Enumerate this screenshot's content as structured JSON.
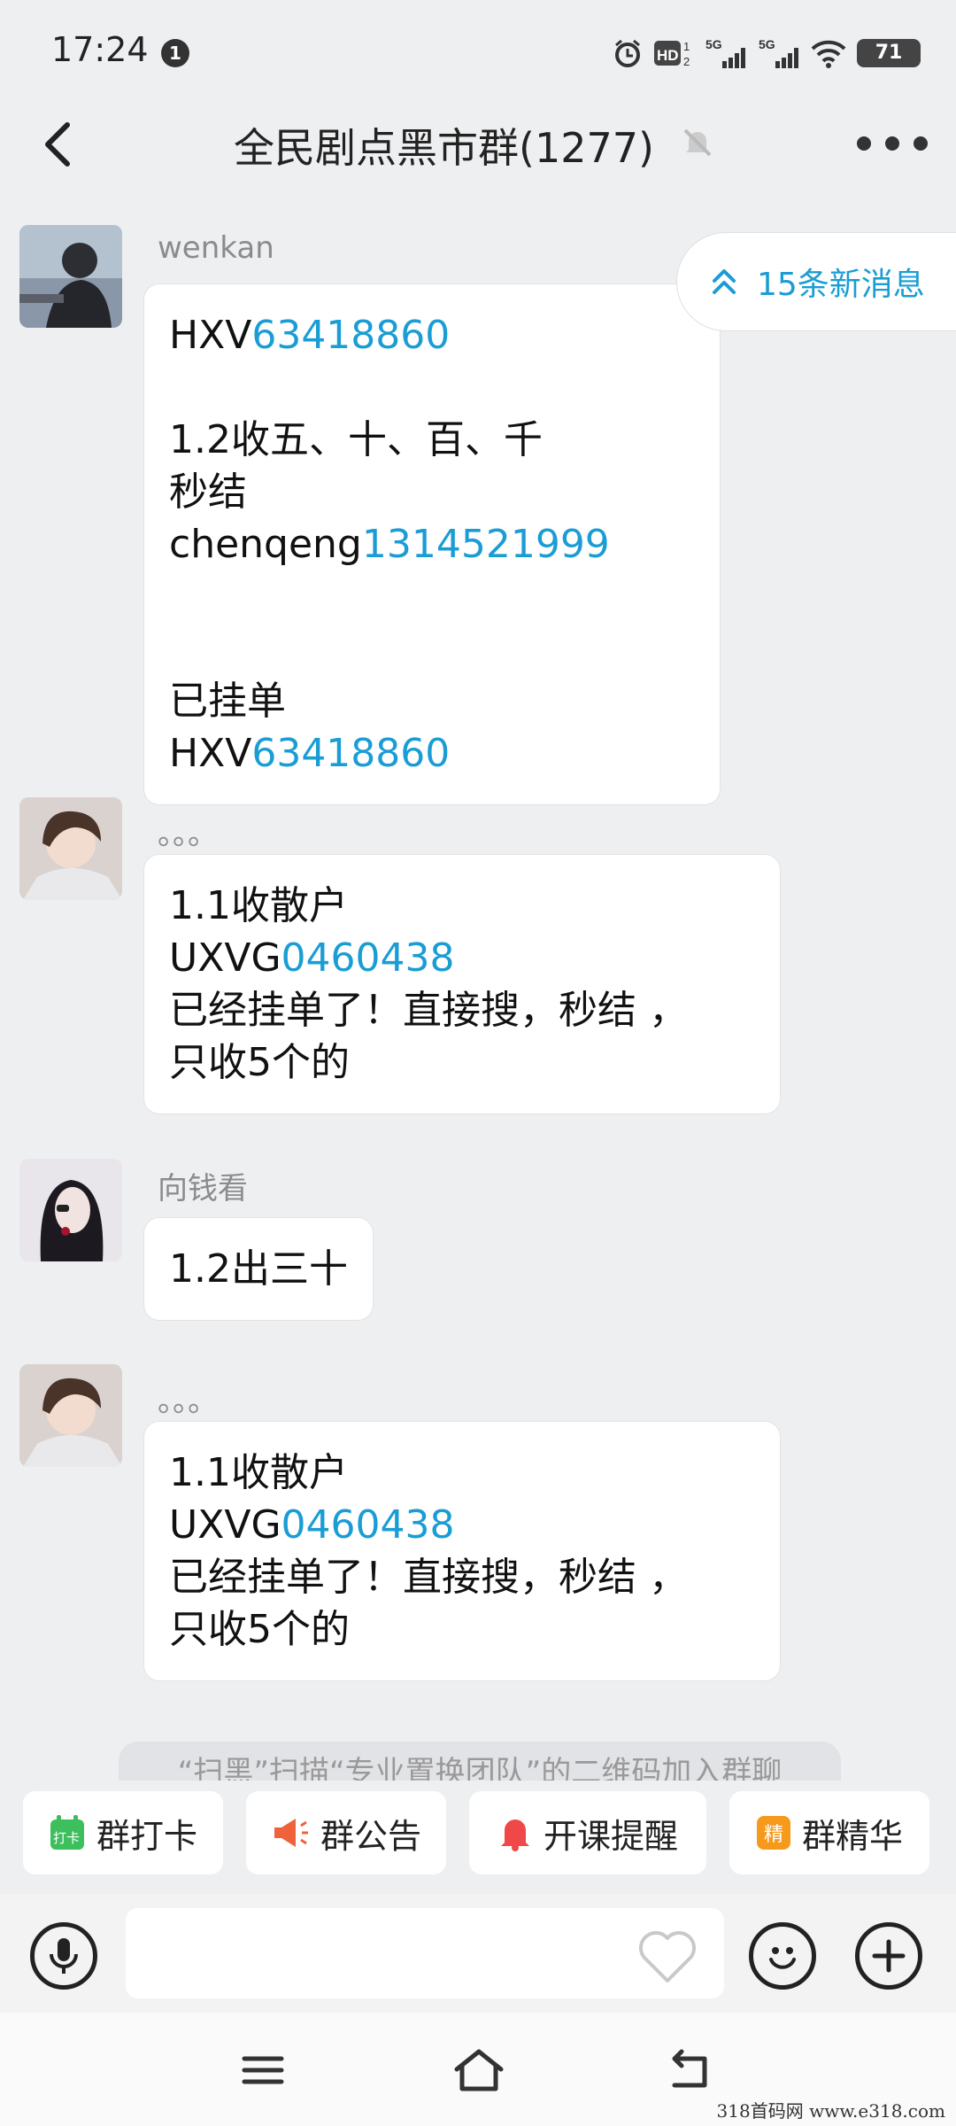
{
  "status_bar": {
    "time": "17:24",
    "notification_count": "1",
    "battery": "71",
    "icons": [
      "alarm-icon",
      "hd-icon",
      "signal-5g-icon",
      "signal-5g-icon",
      "wifi-icon",
      "battery-icon"
    ]
  },
  "header": {
    "title": "全民剧点黑市群(1277)",
    "back_icon": "chevron-left-icon",
    "mute_icon": "bell-muted-icon",
    "more_icon": "more-dots-icon"
  },
  "new_messages": {
    "label": "15条新消息",
    "icon": "double-chevron-up-icon"
  },
  "messages": [
    {
      "sender": "wenkan",
      "lines": [
        [
          {
            "t": "HXV"
          },
          {
            "t": "63418860",
            "link": true
          }
        ],
        [
          {
            "t": ""
          }
        ],
        [
          {
            "t": "1.2收五、十、百、千"
          }
        ],
        [
          {
            "t": "秒结 chenqeng"
          },
          {
            "t": "1314521999",
            "link": true
          }
        ],
        [
          {
            "t": ""
          }
        ],
        [
          {
            "t": ""
          }
        ],
        [
          {
            "t": "已挂单"
          }
        ],
        [
          {
            "t": "HXV"
          },
          {
            "t": "63418860",
            "link": true
          }
        ]
      ]
    },
    {
      "sender": "。。。",
      "lines": [
        [
          {
            "t": "1.1收散户"
          }
        ],
        [
          {
            "t": "UXVG"
          },
          {
            "t": "0460438",
            "link": true
          }
        ],
        [
          {
            "t": "已经挂单了！直接搜，秒结 ，"
          }
        ],
        [
          {
            "t": "只收5个的"
          }
        ]
      ]
    },
    {
      "sender": "向钱看",
      "lines": [
        [
          {
            "t": "1.2出三十"
          }
        ]
      ]
    },
    {
      "sender": "。。。",
      "lines": [
        [
          {
            "t": "1.1收散户"
          }
        ],
        [
          {
            "t": "UXVG"
          },
          {
            "t": "0460438",
            "link": true
          }
        ],
        [
          {
            "t": "已经挂单了！直接搜，秒结 ，"
          }
        ],
        [
          {
            "t": "只收5个的"
          }
        ]
      ]
    }
  ],
  "system_tip": "“扫黑”扫描“专业置换团队”的二维码加入群聊",
  "quick_actions": [
    {
      "label": "群打卡",
      "icon": "checkin-calendar-icon",
      "icon_text": "打卡",
      "color": "#3cbf5c"
    },
    {
      "label": "群公告",
      "icon": "megaphone-icon",
      "color": "#f0623c"
    },
    {
      "label": "开课提醒",
      "icon": "bell-icon",
      "color": "#f04848"
    },
    {
      "label": "群精华",
      "icon": "essence-badge-icon",
      "icon_text": "精",
      "color": "#f59a1b"
    }
  ],
  "input_bar": {
    "voice_icon": "microphone-icon",
    "favorite_icon": "heart-icon",
    "emoji_icon": "smiley-icon",
    "plus_icon": "plus-icon"
  },
  "nav_bar": {
    "icons": [
      "menu-icon",
      "home-icon",
      "back-arrow-icon"
    ]
  },
  "watermark": "318首码网  www.e318.com"
}
